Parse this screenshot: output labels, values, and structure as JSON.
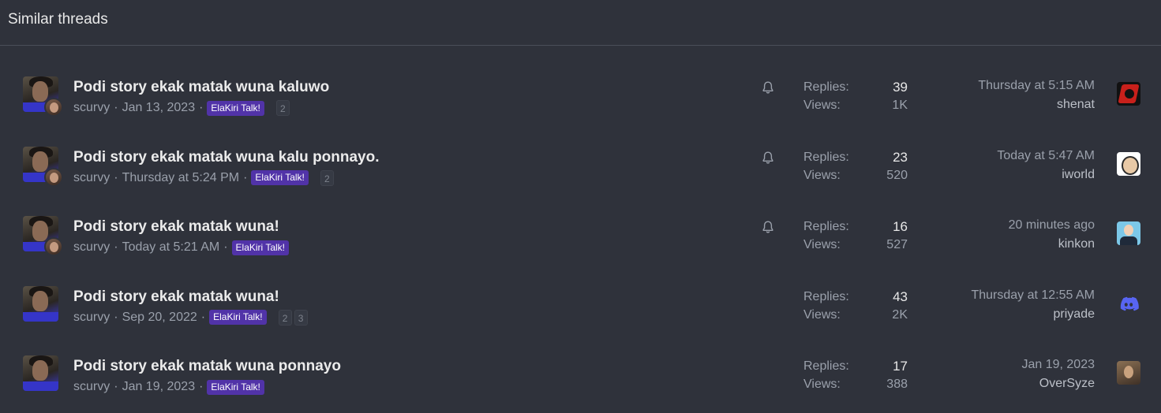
{
  "block": {
    "title": "Similar threads"
  },
  "threads": [
    {
      "title": "Podi story ekak matak wuna kaluwo",
      "author": "scurvy",
      "date": "Jan 13, 2023",
      "prefix": "ElaKiri Talk!",
      "pages": [
        "2"
      ],
      "watched": true,
      "has_participant_avatar": true,
      "replies_label": "Replies:",
      "replies": "39",
      "views_label": "Views:",
      "views": "1K",
      "last_date": "Thursday at 5:15 AM",
      "last_user": "shenat",
      "last_avatar": "shenat-avatar"
    },
    {
      "title": "Podi story ekak matak wuna kalu ponnayo.",
      "author": "scurvy",
      "date": "Thursday at 5:24 PM",
      "prefix": "ElaKiri Talk!",
      "pages": [
        "2"
      ],
      "watched": true,
      "has_participant_avatar": true,
      "replies_label": "Replies:",
      "replies": "23",
      "views_label": "Views:",
      "views": "520",
      "last_date": "Today at 5:47 AM",
      "last_user": "iworld",
      "last_avatar": "iworld-avatar"
    },
    {
      "title": "Podi story ekak matak wuna!",
      "author": "scurvy",
      "date": "Today at 5:21 AM",
      "prefix": "ElaKiri Talk!",
      "pages": [],
      "watched": true,
      "has_participant_avatar": true,
      "replies_label": "Replies:",
      "replies": "16",
      "views_label": "Views:",
      "views": "527",
      "last_date": "20 minutes ago",
      "last_user": "kinkon",
      "last_avatar": "kinkon-avatar"
    },
    {
      "title": "Podi story ekak matak wuna!",
      "author": "scurvy",
      "date": "Sep 20, 2022",
      "prefix": "ElaKiri Talk!",
      "pages": [
        "2",
        "3"
      ],
      "watched": false,
      "has_participant_avatar": false,
      "replies_label": "Replies:",
      "replies": "43",
      "views_label": "Views:",
      "views": "2K",
      "last_date": "Thursday at 12:55 AM",
      "last_user": "priyade",
      "last_avatar": "discord-avatar"
    },
    {
      "title": "Podi story ekak matak wuna ponnayo",
      "author": "scurvy",
      "date": "Jan 19, 2023",
      "prefix": "ElaKiri Talk!",
      "pages": [],
      "watched": false,
      "has_participant_avatar": false,
      "replies_label": "Replies:",
      "replies": "17",
      "views_label": "Views:",
      "views": "388",
      "last_date": "Jan 19, 2023",
      "last_user": "OverSyze",
      "last_avatar": "oversyze-avatar"
    }
  ],
  "separator": "·",
  "colors": {
    "background": "#2f323b",
    "prefix_label": "#5133a8",
    "discord": "#5865f2"
  }
}
